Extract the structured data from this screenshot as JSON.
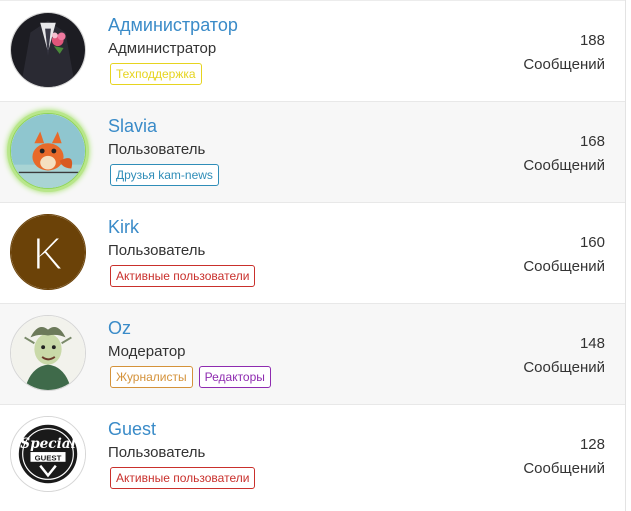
{
  "users": [
    {
      "name": "Администратор",
      "role": "Администратор",
      "avatar": "man-in-suit-with-flower-avatar",
      "badges": [
        {
          "label": "Техподдержка",
          "color": "#e6d41f"
        }
      ],
      "count": "188",
      "count_label": "Сообщений"
    },
    {
      "name": "Slavia",
      "role": "Пользователь",
      "avatar": "cartoon-fox-avatar",
      "badges": [
        {
          "label": "Друзья kam-news",
          "color": "#2f8db8"
        }
      ],
      "count": "168",
      "count_label": "Сообщений"
    },
    {
      "name": "Kirk",
      "role": "Пользователь",
      "avatar": "letter-k-avatar",
      "avatar_letter": "K",
      "badges": [
        {
          "label": "Активные пользователи",
          "color": "#c9302c"
        }
      ],
      "count": "160",
      "count_label": "Сообщений"
    },
    {
      "name": "Oz",
      "role": "Модератор",
      "avatar": "cartoon-wizard-avatar",
      "badges": [
        {
          "label": "Журналисты",
          "color": "#d4923a"
        },
        {
          "label": "Редакторы",
          "color": "#8e2bb0"
        }
      ],
      "count": "148",
      "count_label": "Сообщений"
    },
    {
      "name": "Guest",
      "role": "Пользователь",
      "avatar": "special-guest-logo-avatar",
      "avatar_text": [
        "Special",
        "GUEST"
      ],
      "badges": [
        {
          "label": "Активные пользователи",
          "color": "#c9302c"
        }
      ],
      "count": "128",
      "count_label": "Сообщений"
    }
  ]
}
